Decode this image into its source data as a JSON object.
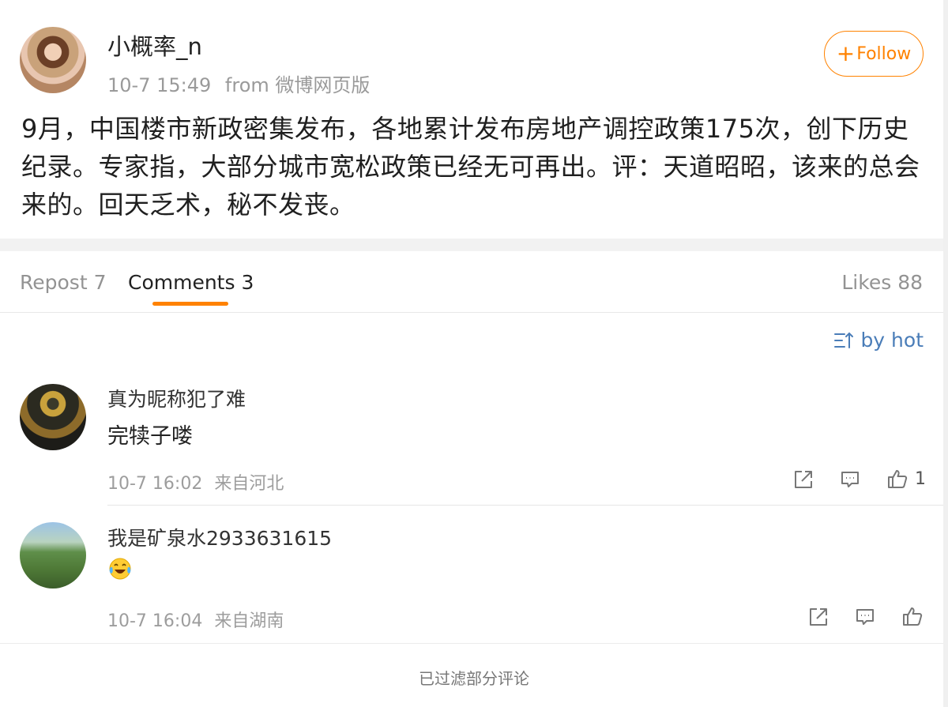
{
  "post": {
    "author": "小概率_n",
    "time": "10-7 15:49",
    "from_label": "from",
    "source": "微博网页版",
    "follow_label": "Follow",
    "text": "9月，中国楼市新政密集发布，各地累计发布房地产调控政策175次，创下历史纪录。专家指，大部分城市宽松政策已经无可再出。评：天道昭昭，该来的总会来的。回天乏术，秘不发丧。"
  },
  "tabs": {
    "repost": "Repost 7",
    "comments": "Comments 3",
    "likes": "Likes 88"
  },
  "sort_label": "by hot",
  "comments": [
    {
      "name": "真为昵称犯了难",
      "body": "完犊子喽",
      "time": "10-7 16:02",
      "location": "来自河北",
      "likes": "1"
    },
    {
      "name": "我是矿泉水2933631615",
      "body_emoji": "laughing-tears-emoji",
      "time": "10-7 16:04",
      "location": "来自湖南",
      "likes": ""
    }
  ],
  "footer_note": "已过滤部分评论",
  "colors": {
    "accent": "#ff8200",
    "link": "#4a7db8",
    "muted": "#9a9a9a"
  }
}
